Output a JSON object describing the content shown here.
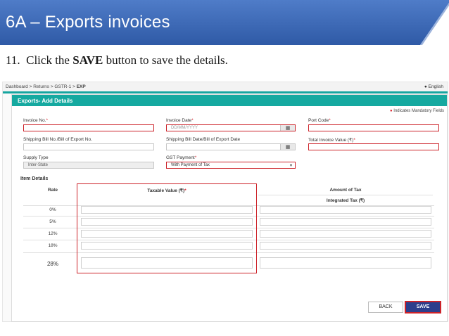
{
  "slide": {
    "title": "6A – Exports invoices",
    "instruction_number": "11.",
    "instruction_prefix": "Click the",
    "instruction_bold": "SAVE",
    "instruction_suffix": "button to save the details."
  },
  "breadcrumb": {
    "items": [
      "Dashboard",
      "Returns",
      "GSTR-1",
      "EXP"
    ],
    "separator": ">",
    "language": "English"
  },
  "form": {
    "title": "Exports- Add Details",
    "mandatory_note": "Indicates Mandatory Fields",
    "fields": {
      "invoice_no": {
        "label": "Invoice No.",
        "value": ""
      },
      "invoice_date": {
        "label": "Invoice Date",
        "placeholder": "DD/MM/YYYY"
      },
      "port_code": {
        "label": "Port Code",
        "value": ""
      },
      "shipping_bill_no": {
        "label": "Shipping Bill No./Bill of Export No.",
        "value": ""
      },
      "shipping_bill_date": {
        "label": "Shipping Bill Date/Bill of Export Date",
        "value": ""
      },
      "total_invoice_value": {
        "label": "Total Invoice Value (₹)",
        "value": ""
      },
      "supply_type": {
        "label": "Supply Type",
        "value": "Inter-State"
      },
      "gst_payment": {
        "label": "GST Payment",
        "value": "With Payment of Tax"
      }
    }
  },
  "item_details": {
    "title": "Item Details",
    "headers": {
      "rate": "Rate",
      "taxable_value": "Taxable Value (₹)",
      "amount_of_tax": "Amount of Tax",
      "integrated_tax": "Integrated Tax (₹)"
    },
    "rates": [
      "0%",
      "5%",
      "12%",
      "18%",
      "28%"
    ]
  },
  "buttons": {
    "back": "BACK",
    "save": "SAVE"
  },
  "colors": {
    "slide_header": "#3d68b4",
    "teal": "#15a9a0",
    "highlight_red": "#cc2229",
    "save_blue": "#2d3e8c"
  }
}
